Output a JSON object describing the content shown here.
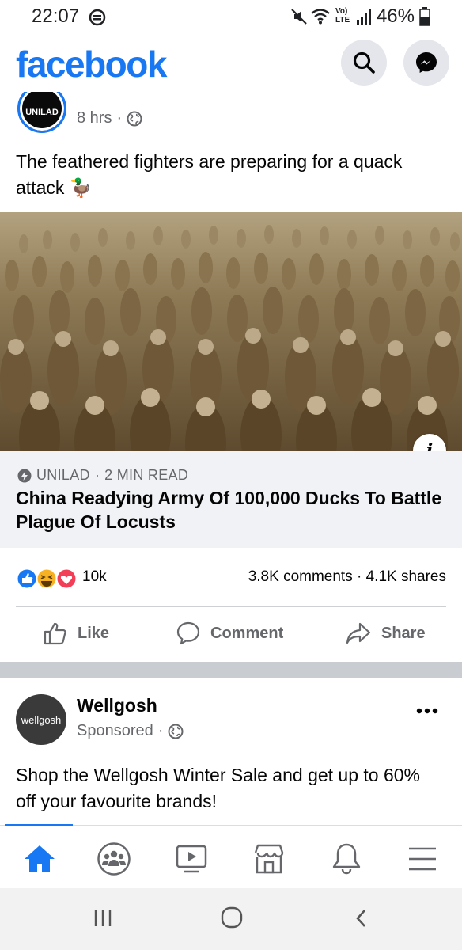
{
  "status_bar": {
    "time": "22:07",
    "network_label": "Vo) LTE",
    "battery": "46%"
  },
  "header": {
    "logo": "facebook",
    "search_icon": "search-icon",
    "messenger_icon": "messenger-icon"
  },
  "post1": {
    "author": "UNILAD",
    "time": "8 hrs",
    "text": "The feathered fighters are preparing for a quack attack 🦆",
    "link": {
      "source": "UNILAD",
      "read_time": "2 MIN READ",
      "title": "China Readying Army Of 100,000 Ducks To Battle Plague Of Locusts"
    },
    "reactions_count": "10k",
    "comments": "3.8K comments",
    "shares": "4.1K shares",
    "actions": {
      "like": "Like",
      "comment": "Comment",
      "share": "Share"
    }
  },
  "post2": {
    "avatar_text": "wellgosh",
    "name": "Wellgosh",
    "sponsored": "Sponsored",
    "text": "Shop the Wellgosh Winter Sale and get up to 60% off your favourite brands!"
  },
  "colors": {
    "brand": "#1877f2",
    "secondary_text": "#65676b",
    "link_box": "#f0f2f5"
  }
}
